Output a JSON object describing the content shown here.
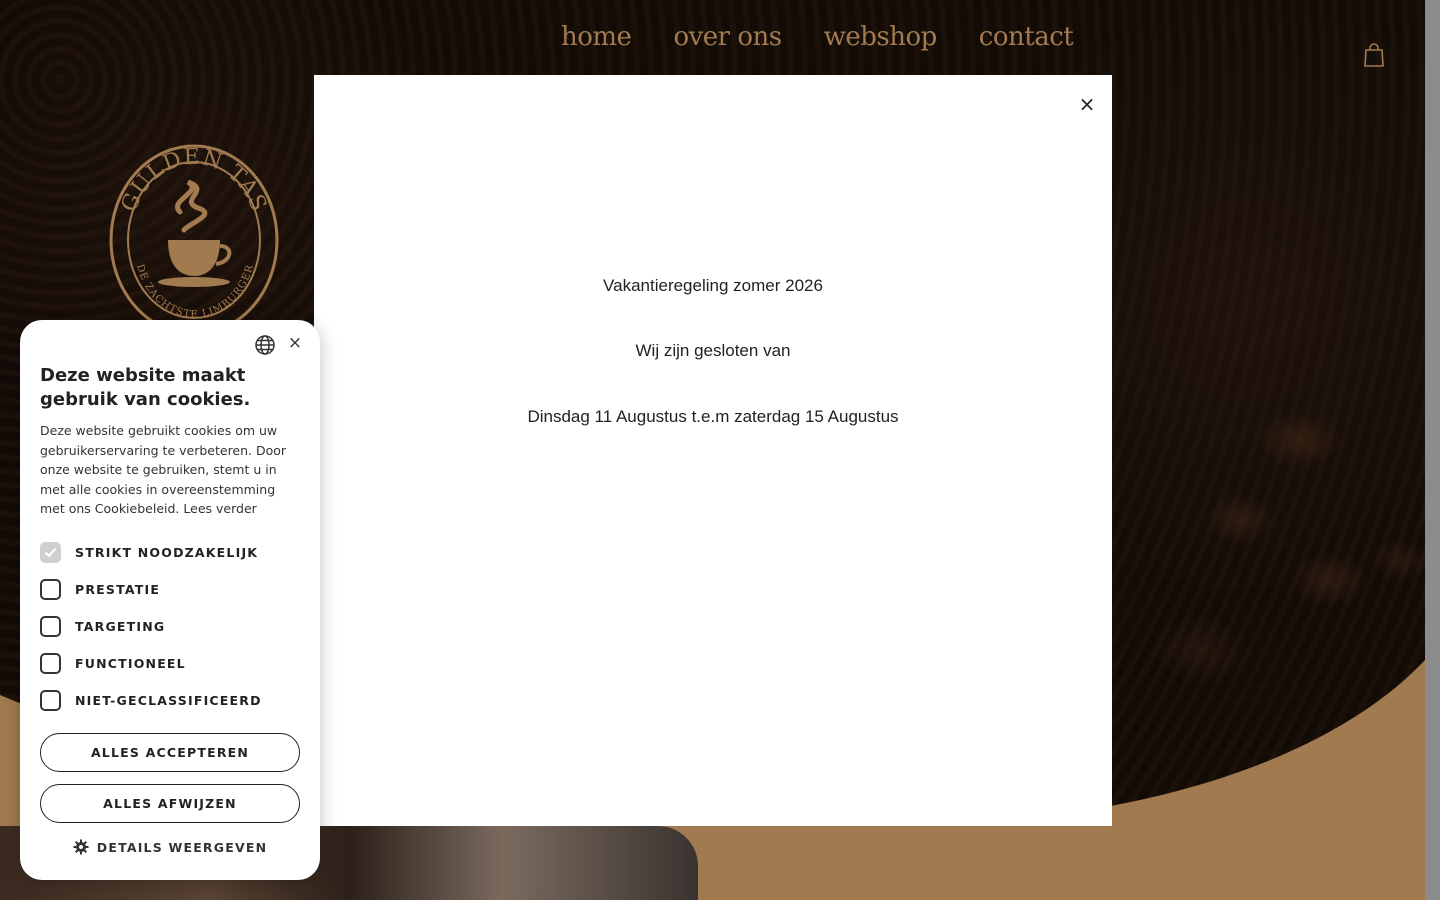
{
  "nav": {
    "items": [
      "home",
      "over ons",
      "webshop",
      "contact"
    ]
  },
  "logo": {
    "top_text": "GULDEN TAS",
    "bottom_text": "DE ZACHTSTE LIMBURGER"
  },
  "colors": {
    "brand_gold": "#a17b4f",
    "modal_bg": "#ffffff",
    "text_dark": "#222222"
  },
  "modal": {
    "close_symbol": "×",
    "line1": "Vakantieregeling zomer 2026",
    "line2": "Wij zijn gesloten van",
    "line3": "Dinsdag 11 Augustus t.e.m zaterdag 15 Augustus"
  },
  "cookie": {
    "close_symbol": "×",
    "title": "Deze website maakt gebruik van cookies.",
    "body": "Deze website gebruikt cookies om uw gebruikerservaring te verbeteren. Door onze website te gebruiken, stemt u in met alle cookies in overeenstemming met ons Cookiebeleid.",
    "read_more": "Lees verder",
    "options": [
      {
        "label": "STRIKT NOODZAKELIJK",
        "checked": true,
        "disabled": true
      },
      {
        "label": "PRESTATIE",
        "checked": false,
        "disabled": false
      },
      {
        "label": "TARGETING",
        "checked": false,
        "disabled": false
      },
      {
        "label": "FUNCTIONEEL",
        "checked": false,
        "disabled": false
      },
      {
        "label": "NIET-GECLASSIFICEERD",
        "checked": false,
        "disabled": false
      }
    ],
    "accept_all": "ALLES ACCEPTEREN",
    "reject_all": "ALLES AFWIJZEN",
    "details": "DETAILS WEERGEVEN"
  }
}
